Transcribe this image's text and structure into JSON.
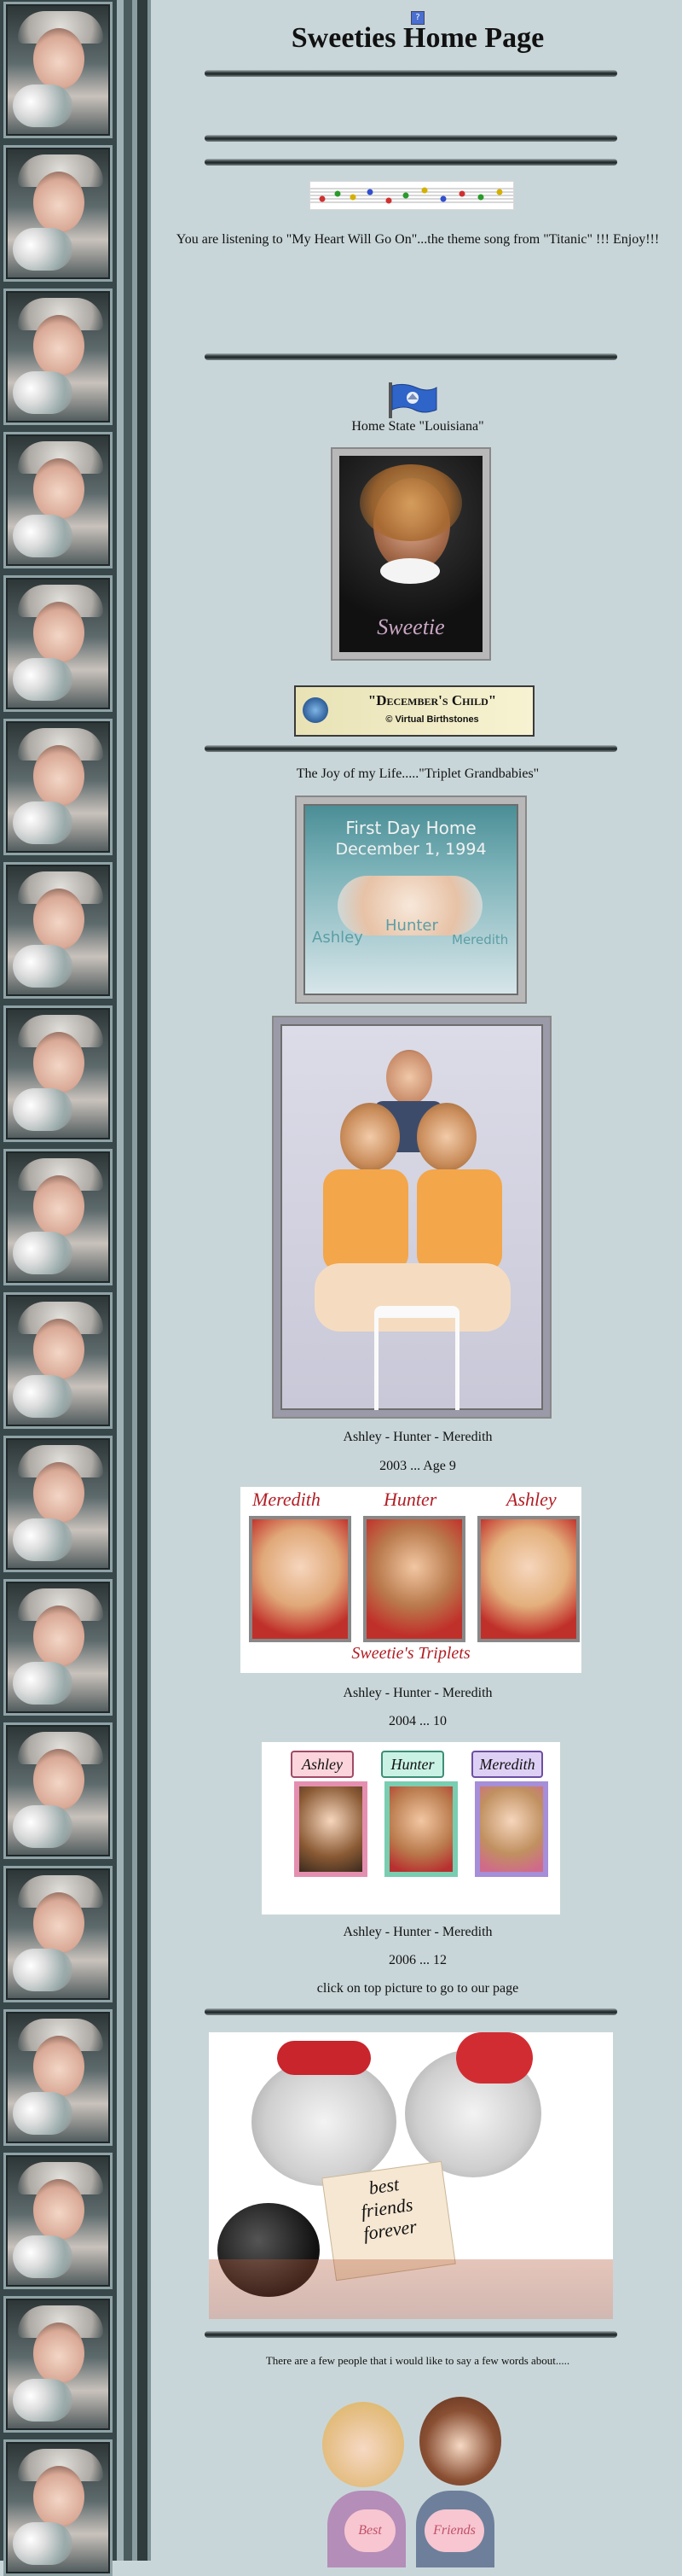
{
  "page": {
    "title": "Sweeties Home Page",
    "background": "#c9d6d9",
    "help_icon": "?"
  },
  "music": {
    "notice": "You are listening to \"My Heart Will Go On\"...the theme song from \"Titanic\" !!! Enjoy!!!"
  },
  "home_state": {
    "caption": "Home State \"Louisiana\""
  },
  "portrait": {
    "signature": "Sweetie"
  },
  "birthstone_banner": {
    "title": "\"December's Child\"",
    "credit": "© Virtual Birthstones"
  },
  "grandbabies": {
    "heading": "The Joy of my Life.....\"Triplet Grandbabies\"",
    "first_day_title": "First Day Home",
    "first_day_date": "December 1, 1994",
    "names": [
      "Ashley",
      "Hunter",
      "Meredith"
    ]
  },
  "photos": [
    {
      "names": "Ashley - Hunter - Meredith",
      "year": "2003 ... Age 9"
    },
    {
      "names": "Ashley - Hunter - Meredith",
      "year": "2004 ... 10"
    },
    {
      "names": "Ashley - Hunter - Meredith",
      "year": "2006 ... 12"
    }
  ],
  "frame_2004": {
    "labels": [
      "Meredith",
      "Hunter",
      "Ashley"
    ],
    "footer": "Sweetie's Triplets"
  },
  "frame_2006": {
    "labels": [
      "Ashley",
      "Hunter",
      "Meredith"
    ]
  },
  "link_hint": "click on top picture to go to our page",
  "bears": {
    "note_line1": "best",
    "note_line2": "friends",
    "note_line3": "forever"
  },
  "few_words": "There are a few people that i would like to say a few words about.....",
  "girls": {
    "label_left": "Best",
    "label_right": "Friends"
  }
}
